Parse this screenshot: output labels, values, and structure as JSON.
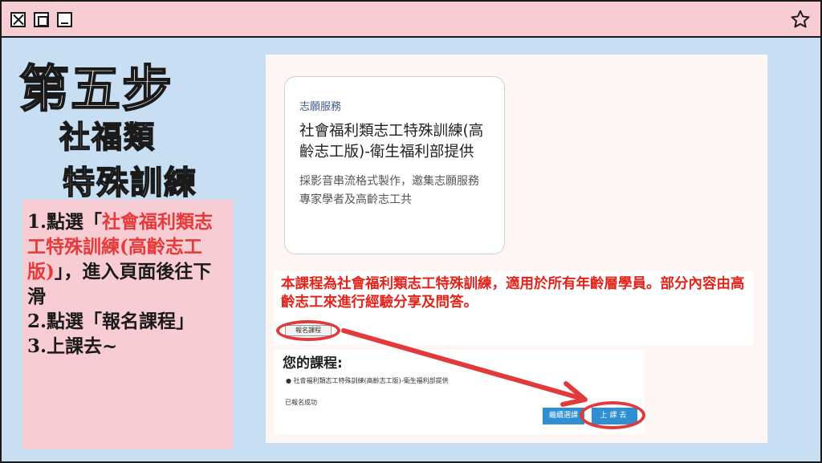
{
  "heading": {
    "step": "第五步",
    "line1": "社福類",
    "line2": "特殊訓練"
  },
  "instructions": {
    "s1_prefix": "1.點選「",
    "s1_highlight": "社會福利類志工特殊訓練(高齡志工版)",
    "s1_suffix": "」，進入頁面後往下滑",
    "s2": "2.點選「報名課程」",
    "s3": "3.上課去~"
  },
  "card": {
    "category": "志願服務",
    "title": "社會福利類志工特殊訓練(高齡志工版)-衛生福利部提供",
    "description": "採影音串流格式製作，邀集志願服務專家學者及高齡志工共"
  },
  "notice": "本課程為社會福利類志工特殊訓練，適用於所有年齡層學員。部分內容由高齡志工來進行經驗分享及問答。",
  "enroll_button": "報名課程",
  "your_courses": {
    "heading": "您的課程:",
    "item": "● 社會福利類志工特殊訓練(高齡志工版)-衛生福利部提供",
    "status": "已報名成功",
    "continue_button": "繼續選課",
    "go_button": "上課去"
  },
  "colors": {
    "title_bar": "#f7cdd3",
    "background": "#c8def2",
    "highlight_red": "#e23a3a",
    "button_blue": "#2f8fd0"
  }
}
